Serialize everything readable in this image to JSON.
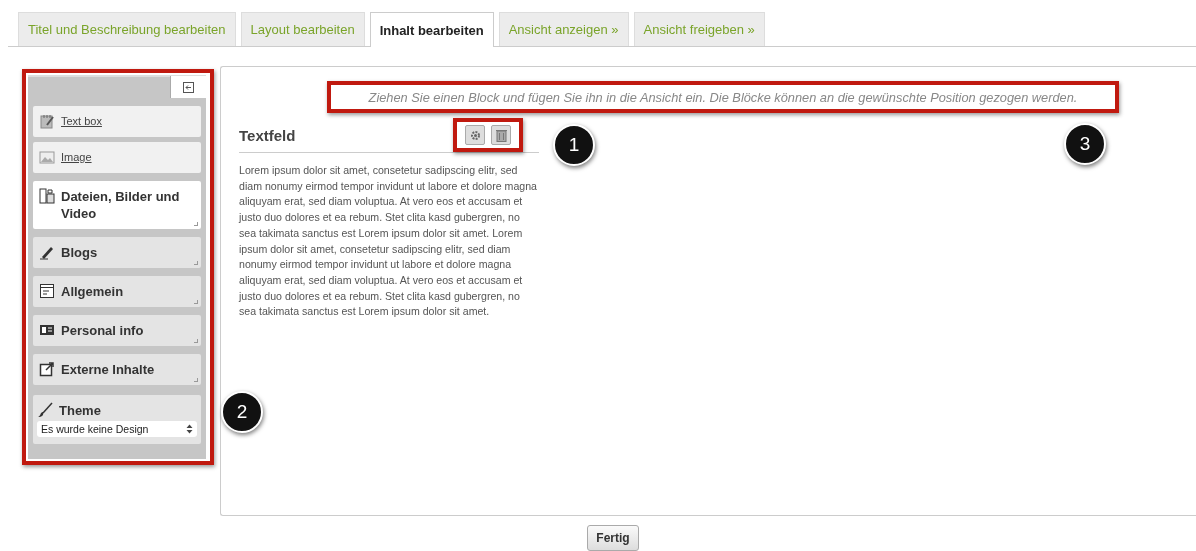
{
  "tabs": [
    {
      "label": "Titel und Beschreibung bearbeiten",
      "selected": false
    },
    {
      "label": "Layout bearbeiten",
      "selected": false
    },
    {
      "label": "Inhalt bearbeiten",
      "selected": true
    },
    {
      "label": "Ansicht anzeigen »",
      "selected": false
    },
    {
      "label": "Ansicht freigeben »",
      "selected": false
    }
  ],
  "sidebar": {
    "blocks": [
      {
        "kind": "link",
        "label": "Text box",
        "selected": false
      },
      {
        "kind": "link",
        "label": "Image",
        "selected": false
      },
      {
        "kind": "category",
        "label": "Dateien, Bilder und Video",
        "selected": true
      },
      {
        "kind": "category",
        "label": "Blogs",
        "selected": false
      },
      {
        "kind": "category",
        "label": "Allgemein",
        "selected": false
      },
      {
        "kind": "category",
        "label": "Personal info",
        "selected": false
      },
      {
        "kind": "category",
        "label": "Externe Inhalte",
        "selected": false
      }
    ],
    "theme": {
      "label": "Theme",
      "value": "Es wurde keine Design"
    }
  },
  "canvas": {
    "hint": "Ziehen Sie einen Block und fügen Sie ihn in die Ansicht ein. Die Blöcke können an die gewünschte Position gezogen werden.",
    "block": {
      "title": "Textfeld",
      "text": "Lorem ipsum dolor sit amet, consetetur sadipscing elitr, sed diam nonumy eirmod tempor invidunt ut labore et dolore magna aliquyam erat, sed diam voluptua. At vero eos et accusam et justo duo dolores et ea rebum. Stet clita kasd gubergren, no sea takimata sanctus est Lorem ipsum dolor sit amet. Lorem ipsum dolor sit amet, consetetur sadipscing elitr, sed diam nonumy eirmod tempor invidunt ut labore et dolore magna aliquyam erat, sed diam voluptua. At vero eos et accusam et justo duo dolores et ea rebum. Stet clita kasd gubergren, no sea takimata sanctus est Lorem ipsum dolor sit amet."
    }
  },
  "callouts": [
    "1",
    "2",
    "3"
  ],
  "done_button": "Fertig"
}
